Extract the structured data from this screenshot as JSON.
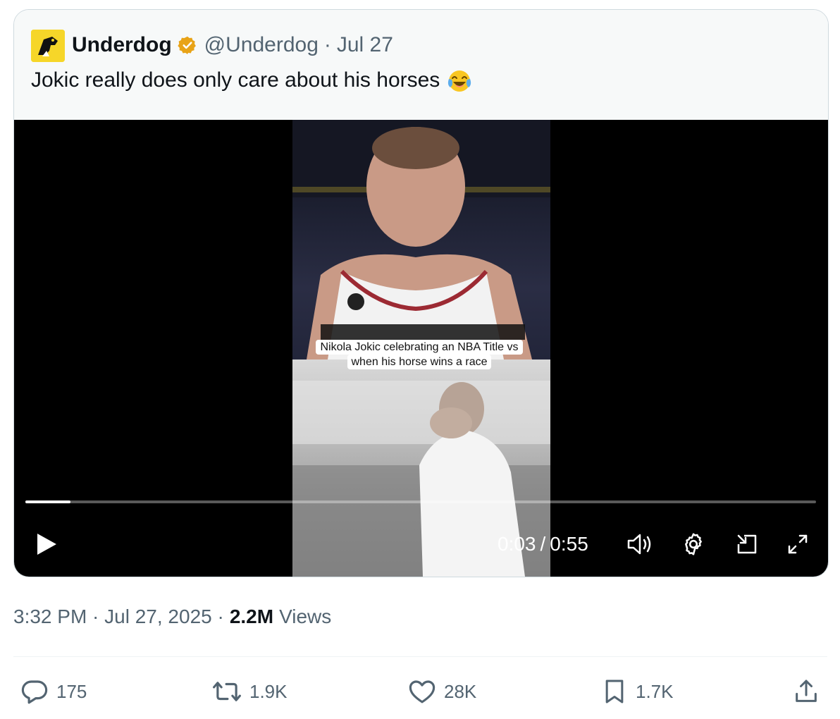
{
  "tweet": {
    "author_name": "Underdog",
    "handle": "@Underdog",
    "separator": "·",
    "date": "Jul 27",
    "text": "Jokic really does only care about his horses",
    "emoji": "face-with-tears-of-joy"
  },
  "video": {
    "caption": "Nikola Jokic celebrating an NBA Title vs when his horse wins a race",
    "current_time": "0:03",
    "time_separator": "/",
    "duration": "0:55",
    "progress_fraction": 0.057
  },
  "meta": {
    "timestamp": "3:32 PM · Jul 27, 2025 ·",
    "views_count": "2.2M",
    "views_label": "Views"
  },
  "actions": {
    "replies": "175",
    "reposts": "1.9K",
    "likes": "28K",
    "bookmarks": "1.7K"
  },
  "colors": {
    "text_primary": "#0f1419",
    "text_secondary": "#536471",
    "verified_gold": "#e8a317",
    "avatar_yellow": "#f6d629",
    "video_bg": "#000000"
  }
}
